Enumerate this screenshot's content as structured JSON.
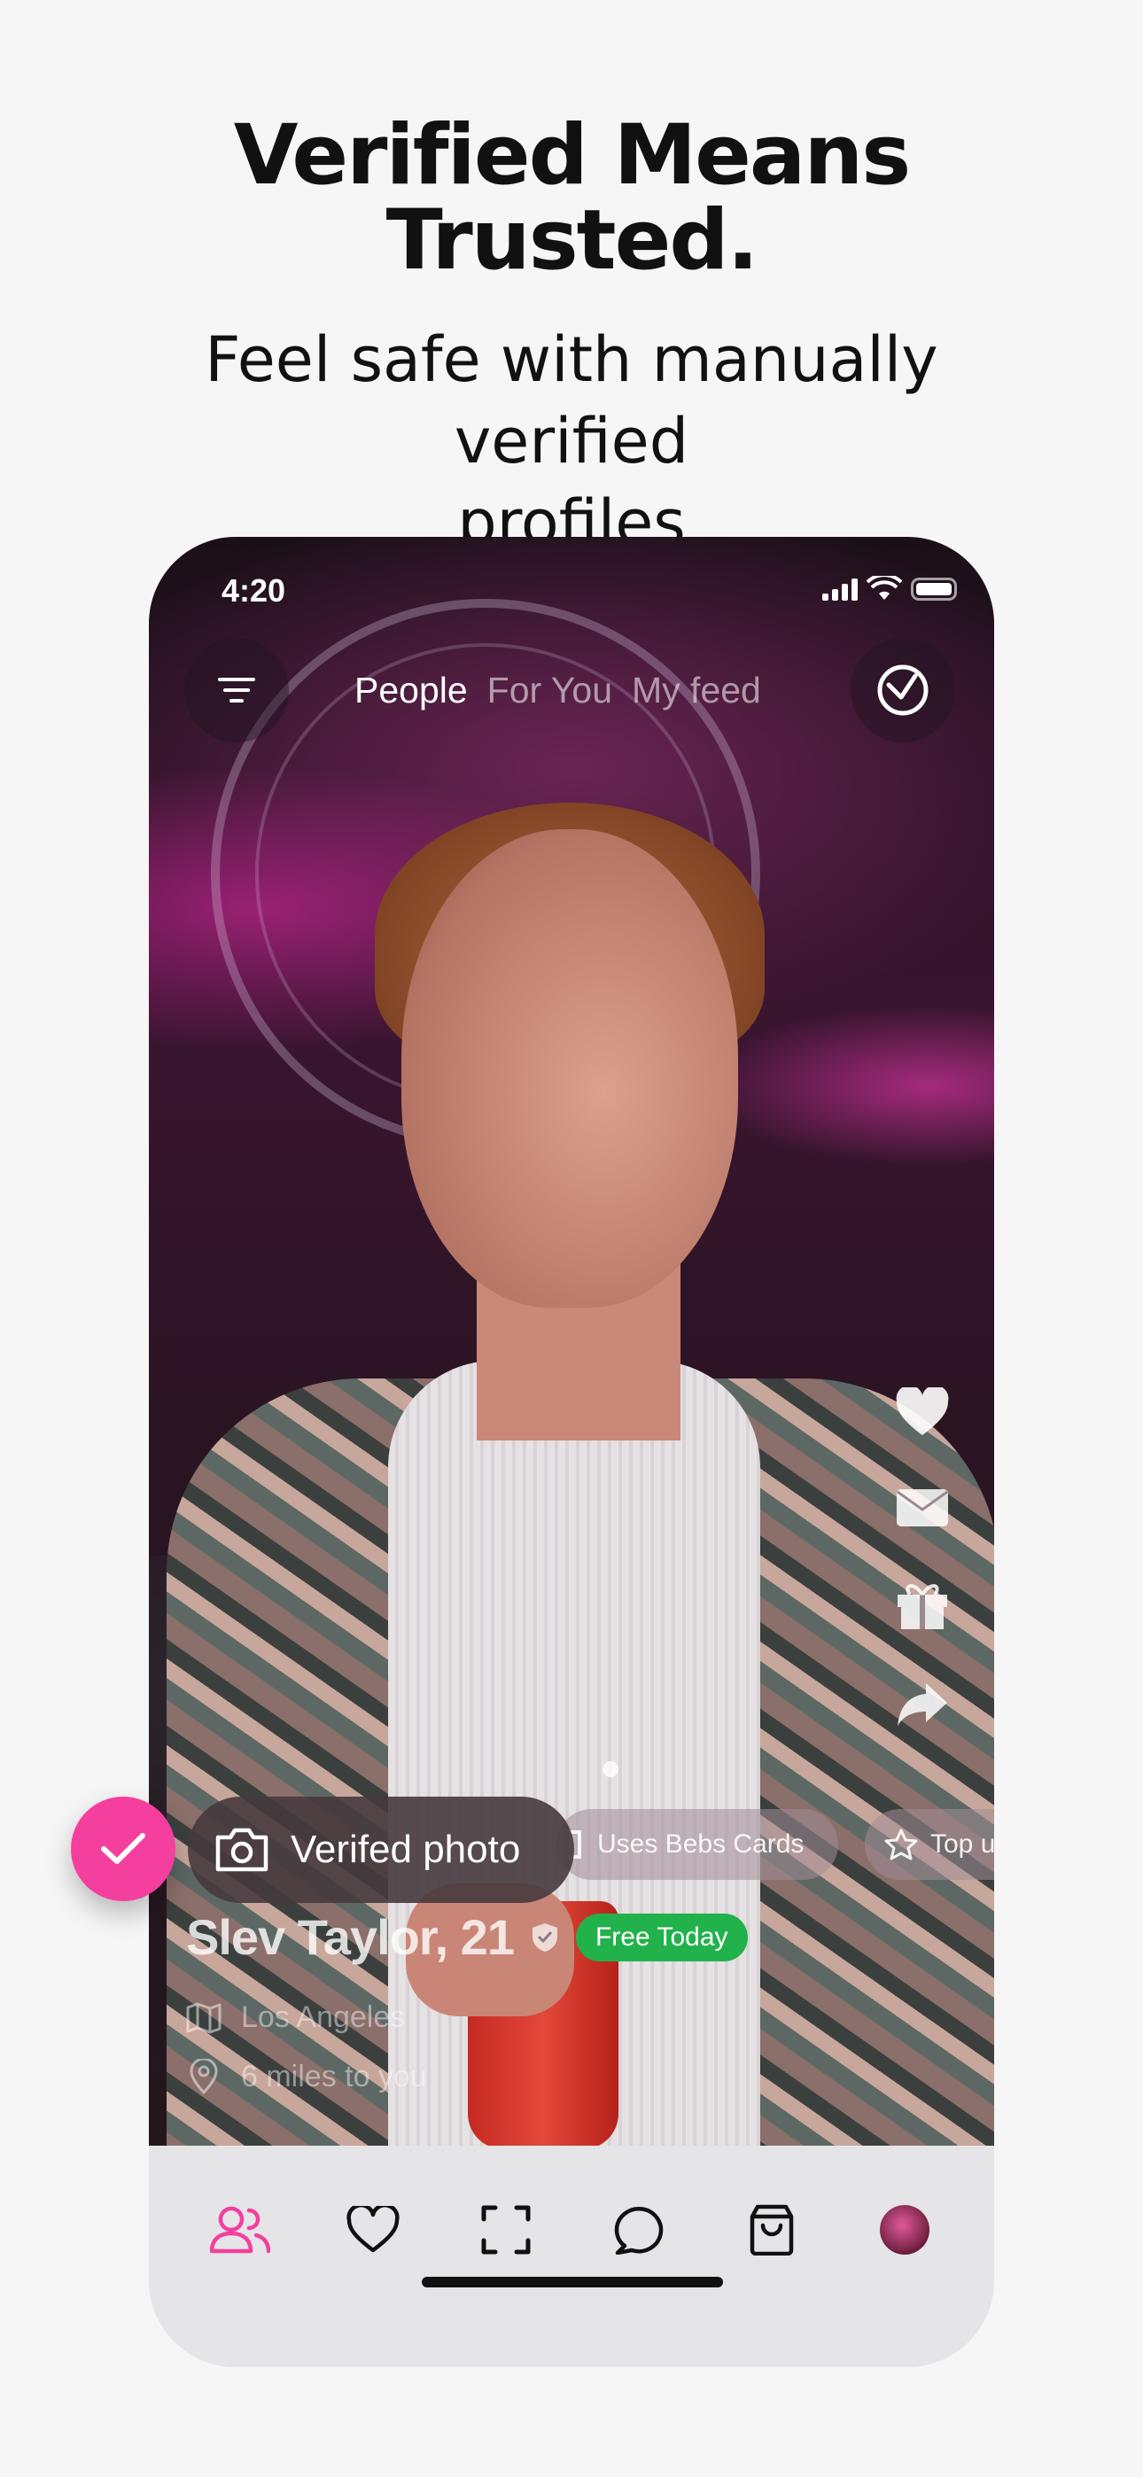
{
  "promo": {
    "headline_line1": "Verified Means",
    "headline_line2": "Trusted.",
    "subheadline_line1": "Feel safe with manually verified",
    "subheadline_line2": "profiles"
  },
  "status_bar": {
    "time": "4:20"
  },
  "top_tabs": [
    {
      "label": "People",
      "active": true
    },
    {
      "label": "For You",
      "active": false
    },
    {
      "label": "My feed",
      "active": false
    }
  ],
  "side_actions": [
    "heart-icon",
    "mail-icon",
    "gift-icon",
    "share-icon"
  ],
  "chips": {
    "verified": "Verifed photo",
    "cards": "Uses Bebs Cards",
    "top": "Top u"
  },
  "profile": {
    "name_age": "Slev Taylor, 21",
    "badge": "Free Today",
    "city": "Los Angeles",
    "distance": "6 miles to you"
  },
  "bottom_nav": [
    {
      "icon": "people-icon",
      "active": true
    },
    {
      "icon": "heart-icon",
      "active": false
    },
    {
      "icon": "scan-icon",
      "active": false
    },
    {
      "icon": "chat-icon",
      "active": false
    },
    {
      "icon": "shopping-bag-icon",
      "active": false
    },
    {
      "icon": "avatar",
      "active": false
    }
  ],
  "colors": {
    "accent": "#f43f9e",
    "badge_green": "#22b24c",
    "background": "#f6f6f7"
  }
}
